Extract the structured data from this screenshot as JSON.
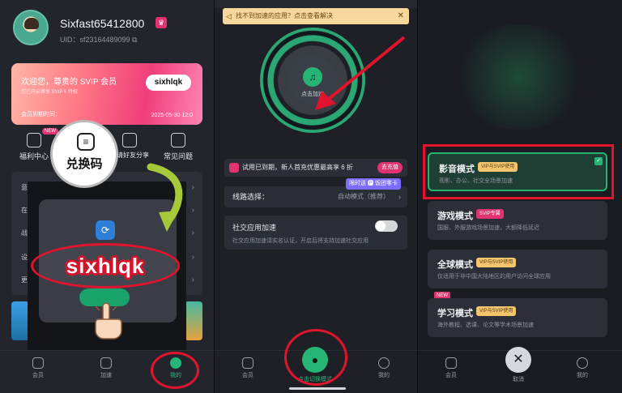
{
  "panel1": {
    "username": "Sixfast65412800",
    "uid": "UID：sf23164489099 ⧉",
    "svip": {
      "title": "欢迎您，尊贵的 SVIP 会员",
      "sub": "您已开启尊享 SVIP 6 特权",
      "code_pill": "sixhlqk",
      "expire_label": "会员到期时间：",
      "expire_date": "2025-05-30 12:0"
    },
    "menu": [
      {
        "label": "福利中心",
        "tag": "NEW"
      },
      {
        "label": "兑换码"
      },
      {
        "label": "邀请好友分享"
      },
      {
        "label": "常见问题"
      }
    ],
    "list_rows": [
      "意",
      "在",
      "战",
      "设",
      "更"
    ],
    "redeem": {
      "label": "兑换码",
      "icon": "≡"
    },
    "code_banner": "sixhlqk",
    "tabs": [
      {
        "label": "会员"
      },
      {
        "label": "加速"
      },
      {
        "label": "我的"
      }
    ]
  },
  "panel2": {
    "notice": {
      "text": "找不到加速的应用？点击查看解决",
      "icon": "◁",
      "close": "✕"
    },
    "disc": {
      "label": "点击加速",
      "icon": "♫"
    },
    "promo": {
      "text": "试用已到期，新人首充优惠最高享 6 折",
      "button": "去充值"
    },
    "limit_tag": "限时送 🅿 饭团零卡",
    "route": {
      "label": "线路选择：",
      "value": "自动模式（推荐）",
      "chevron": "›"
    },
    "social": {
      "title": "社交应用加速",
      "sub": "社交应用加速请实名认证，开启后将支持加速社交应用"
    },
    "tabs": [
      {
        "label": "会员"
      },
      {
        "label": "我的"
      }
    ],
    "center": {
      "label": "点击切换模式",
      "icon": "●"
    }
  },
  "panel3": {
    "modes": [
      {
        "title": "影音模式",
        "tag": "VIP与SVIP使用",
        "desc": "观影、办公、社交全场景加速",
        "active": true
      },
      {
        "title": "游戏模式",
        "tag": "SVIP专属",
        "desc": "国服、外服游戏场景加速，大额降低延迟"
      },
      {
        "title": "全球模式",
        "tag": "VIP与SVIP使用",
        "desc": "仅适用于非中国大陆地区的用户访问全球应用"
      },
      {
        "title": "学习模式",
        "tag": "VIP与SVIP使用",
        "desc": "海外教程、选课、论文等学术场景加速",
        "badge": "NEW"
      }
    ],
    "tabs": [
      {
        "label": "会员"
      },
      {
        "label": "我的"
      }
    ],
    "close": {
      "label": "取消",
      "icon": "✕"
    }
  }
}
